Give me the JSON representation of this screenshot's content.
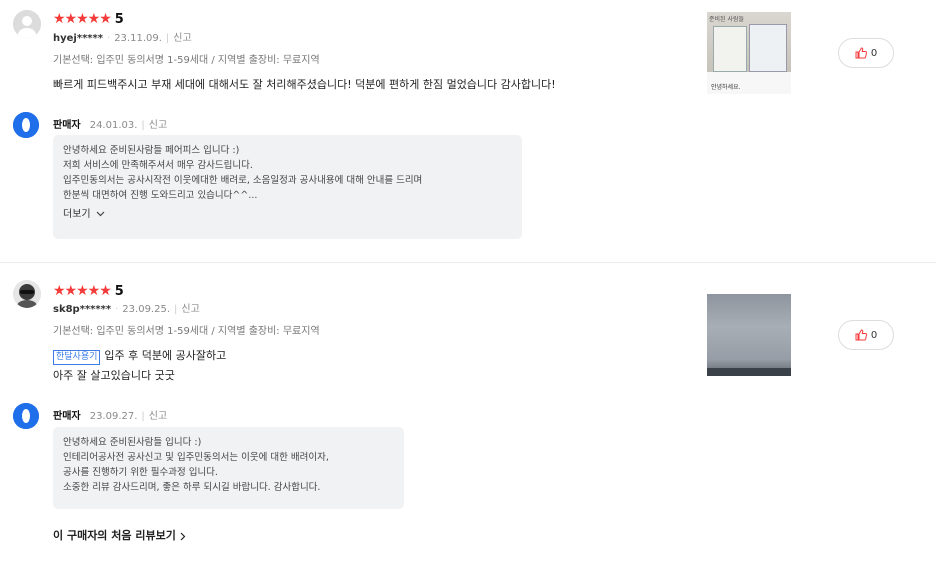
{
  "reviews": [
    {
      "stars": "★★★★★",
      "score": "5",
      "user": "hyej*****",
      "date": "23.11.09.",
      "report": "신고",
      "option": "기본선택: 입주민 동의서명 1-59세대 / 지역별 출장비: 무료지역",
      "text_lines": [
        "빠르게 피드백주시고 부재 세대에 대해서도 잘 처리해주셨습니다! 덕분에 편하게 한짐 멀었습니다 감사합니다!"
      ],
      "badge": "",
      "like_count": "0",
      "seller": {
        "name": "판매자",
        "date": "24.01.03.",
        "report": "신고",
        "lines": [
          "안녕하세요 준비된사람들 페어피스 입니다 :)",
          "저희 서비스에 만족해주셔서 매우 감사드립니다.",
          "입주민동의서는 공사시작전 이웃에대한 배려로, 소음일정과 공사내용에 대해 안내를 드리며",
          "한분씩 대면하여 진행 도와드리고 있습니다^^..."
        ],
        "more": "더보기"
      },
      "thumb_texts": [
        "준비된 사람들",
        "안녕하세요."
      ]
    },
    {
      "stars": "★★★★★",
      "score": "5",
      "user": "sk8p******",
      "date": "23.09.25.",
      "report": "신고",
      "option": "기본선택: 입주민 동의서명 1-59세대 / 지역별 출장비: 무료지역",
      "badge": "한달사용기",
      "text_lines": [
        "입주 후 덕분에 공사잘하고",
        "아주 잘 살고있습니다 굿굿"
      ],
      "like_count": "0",
      "seller": {
        "name": "판매자",
        "date": "23.09.27.",
        "report": "신고",
        "lines": [
          "안녕하세요 준비된사람들 입니다 :)",
          "인테리어공사전 공사신고 및 입주민동의서는 이웃에 대한 배려이자,",
          "공사를 진행하기 위한 필수과정 입니다.",
          "소중한 리뷰 감사드리며, 좋은 하루 되시길 바랍니다. 감사합니다."
        ]
      }
    }
  ],
  "first_review_link": "이 구매자의 처음 리뷰보기",
  "colors": {
    "star": "#f53a3a",
    "seller_icon": "#1f6feb",
    "badge": "#3c7be8"
  }
}
